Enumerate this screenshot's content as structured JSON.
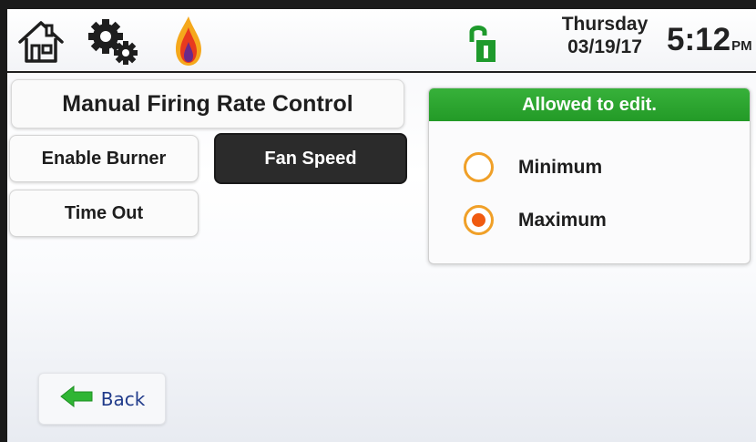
{
  "topbar": {
    "icons": [
      "home-icon",
      "gear-icon",
      "flame-icon",
      "lock-icon"
    ],
    "day": "Thursday",
    "date": "03/19/17",
    "time": "5:12",
    "ampm": "PM"
  },
  "panel": {
    "title": "Manual Firing Rate Control"
  },
  "buttons": {
    "enable_burner": "Enable Burner",
    "fan_speed": "Fan Speed",
    "time_out": "Time Out"
  },
  "fan_speed_selected": true,
  "edit": {
    "header": "Allowed to edit.",
    "options": [
      {
        "label": "Minimum",
        "checked": false
      },
      {
        "label": "Maximum",
        "checked": true
      }
    ]
  },
  "back": {
    "label": "Back",
    "icon": "arrow-left-icon"
  },
  "colors": {
    "accent_green": "#2aa52e",
    "radio_ring": "#f0a028",
    "radio_dot": "#f05a10",
    "dark_button": "#2b2b2b"
  }
}
